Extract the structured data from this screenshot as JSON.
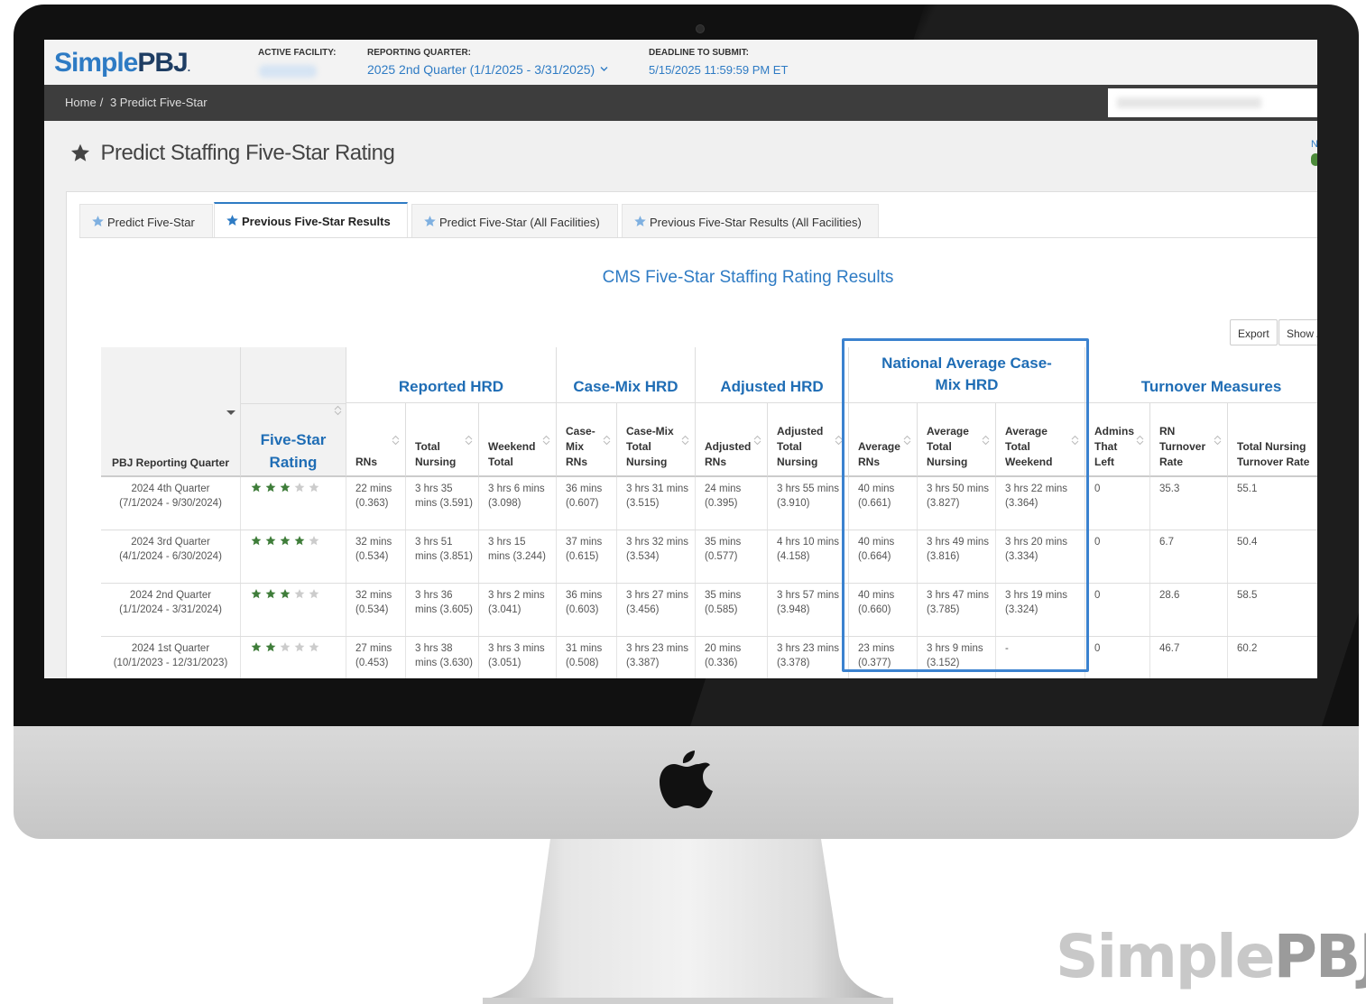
{
  "app": {
    "logo_part1": "Simple",
    "logo_part2": "PBJ",
    "logo_tm": ".",
    "watermark_part1": "Simple",
    "watermark_part2": "PBJ"
  },
  "topbar": {
    "active_facility_label": "ACTIVE FACILITY:",
    "reporting_quarter_label": "REPORTING QUARTER:",
    "reporting_quarter_value": "2025 2nd Quarter (1/1/2025 - 3/31/2025)",
    "deadline_label": "DEADLINE TO SUBMIT:",
    "deadline_value": "5/15/2025 11:59:59 PM ET"
  },
  "breadcrumb": {
    "home": "Home",
    "separator": "/",
    "current": "3 Predict Five-Star"
  },
  "page": {
    "title": "Predict Staffing Five-Star Rating",
    "edge_text": "N"
  },
  "tabs": [
    {
      "label": "Predict Five-Star",
      "active": false
    },
    {
      "label": "Previous Five-Star Results",
      "active": true
    },
    {
      "label": "Predict Five-Star (All Facilities)",
      "active": false
    },
    {
      "label": "Previous Five-Star Results (All Facilities)",
      "active": false
    }
  ],
  "results": {
    "title": "CMS Five-Star Staffing Rating Results",
    "export_label": "Export",
    "show_label": "Show /"
  },
  "table": {
    "pbj_header": "PBJ Reporting Quarter",
    "five_star_header": "Five-Star Rating",
    "groups": {
      "reported": "Reported HRD",
      "casemix": "Case-Mix HRD",
      "adjusted": "Adjusted HRD",
      "national": "National Average Case-Mix HRD",
      "turnover": "Turnover Measures"
    },
    "columns": {
      "rns": "RNs",
      "total_nursing": "Total Nursing",
      "weekend_total": "Weekend Total",
      "casemix_rns": "Case-Mix RNs",
      "casemix_total": "Case-Mix Total Nursing",
      "adjusted_rns": "Adjusted RNs",
      "adjusted_total": "Adjusted Total Nursing",
      "avg_rns": "Average RNs",
      "avg_total": "Average Total Nursing",
      "avg_weekend": "Average Total Weekend",
      "admins_left": "Admins That Left",
      "rn_turnover": "RN Turnover Rate",
      "total_turnover": "Total Nursing Turnover Rate"
    },
    "rows": [
      {
        "quarter": "2024 4th Quarter",
        "range": "(7/1/2024 - 9/30/2024)",
        "stars": 3,
        "rns": "22 mins (0.363)",
        "total_nursing": "3 hrs 35 mins (3.591)",
        "weekend_total": "3 hrs 6 mins (3.098)",
        "casemix_rns": "36 mins (0.607)",
        "casemix_total": "3 hrs 31 mins (3.515)",
        "adjusted_rns": "24 mins (0.395)",
        "adjusted_total": "3 hrs 55 mins (3.910)",
        "avg_rns": "40 mins (0.661)",
        "avg_total": "3 hrs 50 mins (3.827)",
        "avg_weekend": "3 hrs 22 mins (3.364)",
        "admins_left": "0",
        "rn_turnover": "35.3",
        "total_turnover": "55.1"
      },
      {
        "quarter": "2024 3rd Quarter",
        "range": "(4/1/2024 - 6/30/2024)",
        "stars": 4,
        "rns": "32 mins (0.534)",
        "total_nursing": "3 hrs 51 mins (3.851)",
        "weekend_total": "3 hrs 15 mins (3.244)",
        "casemix_rns": "37 mins (0.615)",
        "casemix_total": "3 hrs 32 mins (3.534)",
        "adjusted_rns": "35 mins (0.577)",
        "adjusted_total": "4 hrs 10 mins (4.158)",
        "avg_rns": "40 mins (0.664)",
        "avg_total": "3 hrs 49 mins (3.816)",
        "avg_weekend": "3 hrs 20 mins (3.334)",
        "admins_left": "0",
        "rn_turnover": "6.7",
        "total_turnover": "50.4"
      },
      {
        "quarter": "2024 2nd Quarter",
        "range": "(1/1/2024 - 3/31/2024)",
        "stars": 3,
        "rns": "32 mins (0.534)",
        "total_nursing": "3 hrs 36 mins (3.605)",
        "weekend_total": "3 hrs 2 mins (3.041)",
        "casemix_rns": "36 mins (0.603)",
        "casemix_total": "3 hrs 27 mins (3.456)",
        "adjusted_rns": "35 mins (0.585)",
        "adjusted_total": "3 hrs 57 mins (3.948)",
        "avg_rns": "40 mins (0.660)",
        "avg_total": "3 hrs 47 mins (3.785)",
        "avg_weekend": "3 hrs 19 mins (3.324)",
        "admins_left": "0",
        "rn_turnover": "28.6",
        "total_turnover": "58.5"
      },
      {
        "quarter": "2024 1st Quarter",
        "range": "(10/1/2023 - 12/31/2023)",
        "stars": 2,
        "rns": "27 mins (0.453)",
        "total_nursing": "3 hrs 38 mins (3.630)",
        "weekend_total": "3 hrs 3 mins (3.051)",
        "casemix_rns": "31 mins (0.508)",
        "casemix_total": "3 hrs 23 mins (3.387)",
        "adjusted_rns": "20 mins (0.336)",
        "adjusted_total": "3 hrs 23 mins (3.378)",
        "avg_rns": "23 mins (0.377)",
        "avg_total": "3 hrs 9 mins (3.152)",
        "avg_weekend": "-",
        "admins_left": "0",
        "rn_turnover": "46.7",
        "total_turnover": "60.2"
      }
    ]
  },
  "colors": {
    "brand_blue": "#2e7bc4",
    "brand_navy": "#1e3d63",
    "star_green": "#3f7d3a",
    "star_empty": "#cccccc",
    "highlight": "#3b82cf"
  },
  "icons": [
    "star-icon",
    "sort-icon",
    "caret-down-icon",
    "apple-icon",
    "chevron-down-icon"
  ]
}
